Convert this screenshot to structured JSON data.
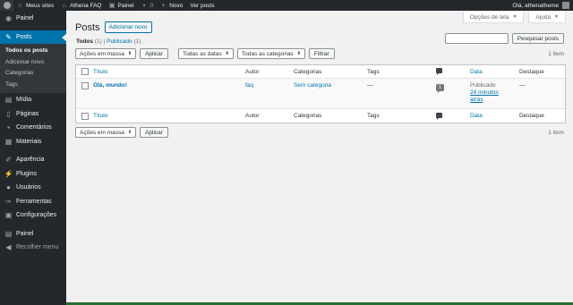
{
  "adminbar": {
    "site_name": "Meus sites",
    "site": "Athena FAQ",
    "dashboard": "Painel",
    "comments_count": "0",
    "new": "Novo",
    "view_posts": "Ver posts",
    "greeting": "Olá, athenatheme"
  },
  "sidebar": {
    "items": [
      {
        "label": "Painel",
        "icon": "dashboard-icon"
      },
      {
        "label": "Posts",
        "icon": "pin-icon"
      },
      {
        "label": "Mídia",
        "icon": "media-icon"
      },
      {
        "label": "Páginas",
        "icon": "page-icon"
      },
      {
        "label": "Comentários",
        "icon": "comment-icon"
      },
      {
        "label": "Materiais",
        "icon": "materials-icon"
      },
      {
        "label": "Aparência",
        "icon": "brush-icon"
      },
      {
        "label": "Plugins",
        "icon": "plugin-icon"
      },
      {
        "label": "Usuários",
        "icon": "users-icon"
      },
      {
        "label": "Ferramentas",
        "icon": "wrench-icon"
      },
      {
        "label": "Configurações",
        "icon": "settings-icon"
      },
      {
        "label": "Painel",
        "icon": "panel-icon"
      },
      {
        "label": "Recolher menu",
        "icon": "collapse-icon"
      }
    ],
    "submenu": [
      "Todos os posts",
      "Adicionar novo",
      "Categorias",
      "Tags"
    ]
  },
  "screen_meta": {
    "options": "Opções de tela",
    "help": "Ajuda"
  },
  "page": {
    "title": "Posts",
    "add_new": "Adicionar novo",
    "views": {
      "all_label": "Todos",
      "all_count": "(1)",
      "separator": "|",
      "published_label": "Publicado",
      "published_count": "(1)"
    },
    "search_button": "Pesquisar posts",
    "bulk_actions": "Ações em massa",
    "apply": "Aplicar",
    "all_dates": "Todas as datas",
    "all_categories": "Todas as categorias",
    "filter": "Filtrar",
    "items_count": "1 item"
  },
  "table": {
    "columns": [
      "Título",
      "Autor",
      "Categorias",
      "Tags",
      "",
      "Data",
      "Destaque"
    ],
    "rows": [
      {
        "title": "Olá, mundo!",
        "author": "faq",
        "category": "Sem categoria",
        "tags": "—",
        "comments": "1",
        "date_status": "Publicado",
        "date_line1": "24 minutos",
        "date_line2": "atrás",
        "featured": "—"
      }
    ]
  },
  "colors": {
    "adminbar_bg": "#23282d",
    "sidebar_bg": "#23282d",
    "accent": "#0073aa",
    "content_bg": "#f1f1f1"
  }
}
